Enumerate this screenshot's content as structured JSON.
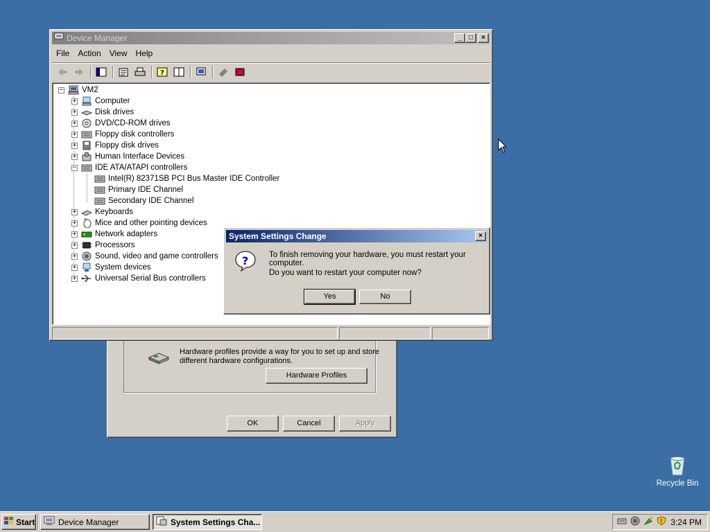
{
  "background_window": {
    "hardware_profiles_text": "Hardware profiles provide a way for you to set up and store different hardware configurations.",
    "hardware_profiles_button": "Hardware Profiles",
    "ok_button": "OK",
    "cancel_button": "Cancel",
    "apply_button": "Apply"
  },
  "device_manager": {
    "title": "Device Manager",
    "menu": [
      "File",
      "Action",
      "View",
      "Help"
    ],
    "tree": {
      "root": "VM2",
      "items": [
        {
          "label": "Computer",
          "icon": "computer-icon"
        },
        {
          "label": "Disk drives",
          "icon": "disk-drive-icon"
        },
        {
          "label": "DVD/CD-ROM drives",
          "icon": "cdrom-icon"
        },
        {
          "label": "Floppy disk controllers",
          "icon": "controller-icon"
        },
        {
          "label": "Floppy disk drives",
          "icon": "floppy-icon"
        },
        {
          "label": "Human Interface Devices",
          "icon": "hid-icon"
        },
        {
          "label": "IDE ATA/ATAPI controllers",
          "icon": "controller-icon",
          "children": [
            "Intel(R) 82371SB PCI Bus Master IDE Controller",
            "Primary IDE Channel",
            "Secondary IDE Channel"
          ]
        },
        {
          "label": "Keyboards",
          "icon": "keyboard-icon"
        },
        {
          "label": "Mice and other pointing devices",
          "icon": "mouse-icon"
        },
        {
          "label": "Network adapters",
          "icon": "network-icon"
        },
        {
          "label": "Processors",
          "icon": "processor-icon"
        },
        {
          "label": "Sound, video and game controllers",
          "icon": "sound-icon"
        },
        {
          "label": "System devices",
          "icon": "system-icon"
        },
        {
          "label": "Universal Serial Bus controllers",
          "icon": "usb-icon"
        }
      ]
    }
  },
  "dialog": {
    "title": "System Settings Change",
    "message1": "To finish removing your hardware, you must restart your computer.",
    "message2": "Do you want to restart your computer now?",
    "yes_button": "Yes",
    "no_button": "No"
  },
  "desktop": {
    "recycle_bin_label": "Recycle Bin"
  },
  "taskbar": {
    "start_label": "Start",
    "tasks": [
      "Device Manager",
      "System Settings Cha..."
    ],
    "clock": "3:24 PM"
  },
  "colors": {
    "desktop": "#3a6ea5",
    "active_title": "#0a246a",
    "inactive_title": "#808080",
    "face": "#d4d0c8"
  }
}
